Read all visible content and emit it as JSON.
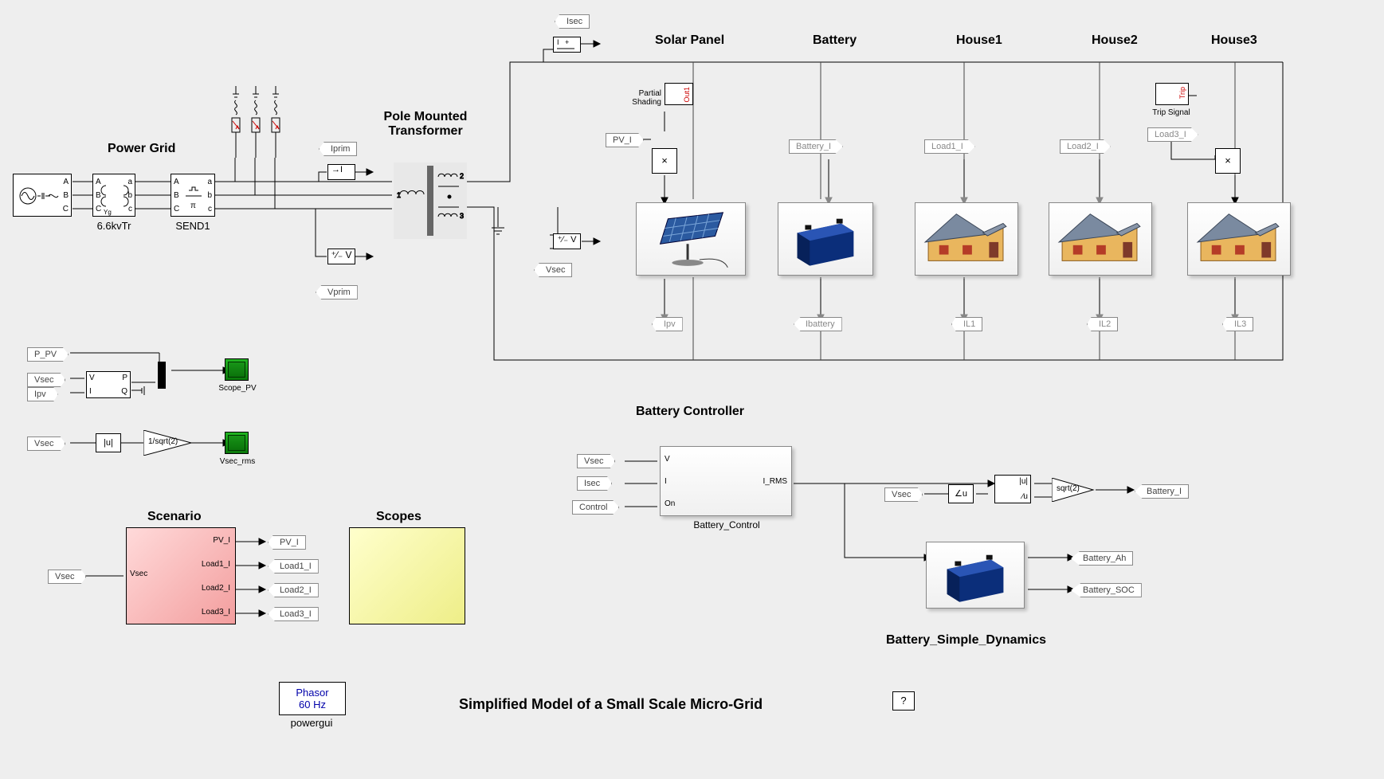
{
  "main_title": "Simplified Model of a Small Scale Micro-Grid",
  "sections": {
    "power_grid": "Power Grid",
    "pole_transformer": "Pole Mounted\nTransformer",
    "solar_panel": "Solar Panel",
    "battery": "Battery",
    "house1": "House1",
    "house2": "House2",
    "house3": "House3",
    "battery_controller": "Battery Controller",
    "scenario": "Scenario",
    "scopes": "Scopes",
    "battery_dynamics": "Battery_Simple_Dynamics"
  },
  "blocks": {
    "tr66kv": "6.6kvTr",
    "send1": "SEND1",
    "powergui_title": "powergui",
    "phasor_line1": "Phasor",
    "phasor_line2": "60 Hz",
    "battery_control_block": "Battery_Control",
    "partial_shading": "Partial\nShading",
    "trip_signal": "Trip Signal",
    "help": "?",
    "sqrt2": "sqrt(2)",
    "invsqrt2": "1/sqrt(2)",
    "abs_u": "|u|",
    "angle_u": "∠u",
    "abs_u2": "|u|",
    "star_u": "∕u",
    "times": "×",
    "out1": "Out1",
    "trip": "Trip",
    "scope_pv": "Scope_PV",
    "vsec_rms": "Vsec_rms"
  },
  "tags": {
    "iprim": "Iprim",
    "vprim": "Vprim",
    "isec": "Isec",
    "vsec": "Vsec",
    "p_pv": "P_PV",
    "ipv": "Ipv",
    "pv_i": "PV_I",
    "battery_i": "Battery_I",
    "load1_i": "Load1_I",
    "load2_i": "Load2_I",
    "load3_i": "Load3_I",
    "ipv_out": "Ipv",
    "ibattery": "Ibattery",
    "il1": "IL1",
    "il2": "IL2",
    "il3": "IL3",
    "control": "Control",
    "irms": "I_RMS",
    "battery_ah": "Battery_Ah",
    "battery_soc": "Battery_SOC"
  },
  "scenario_ports": {
    "in": "Vsec",
    "out": [
      "PV_I",
      "Load1_I",
      "Load2_I",
      "Load3_I"
    ]
  },
  "bc_ports": {
    "v": "V",
    "i": "I",
    "on": "On",
    "out": "I_RMS"
  },
  "pq_ports": {
    "v": "V",
    "i": "I",
    "p": "P",
    "q": "Q"
  },
  "source_ports": {
    "a": "A",
    "b": "B",
    "c": "C",
    "al": "a",
    "bl": "b",
    "cl": "c"
  }
}
